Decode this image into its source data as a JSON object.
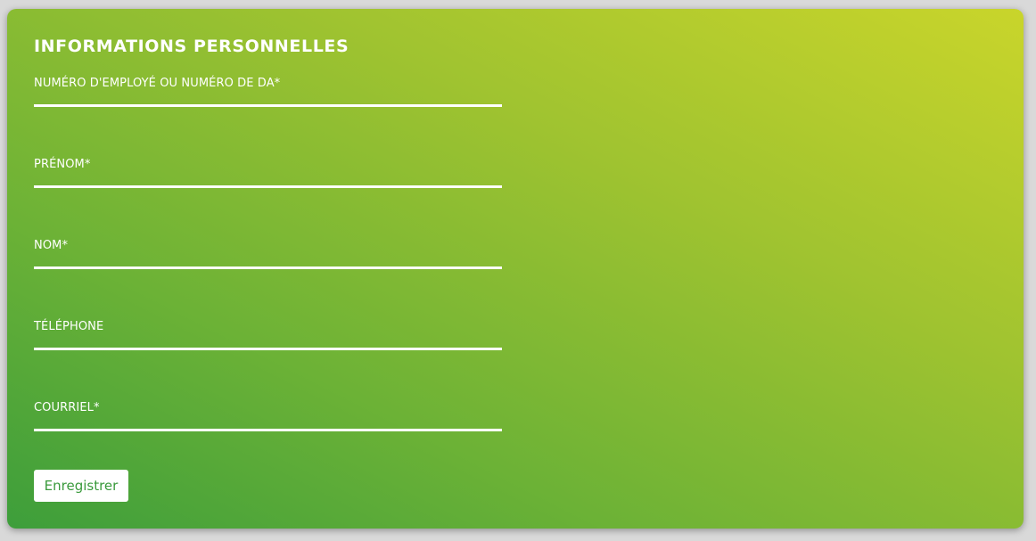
{
  "form": {
    "title": "INFORMATIONS PERSONNELLES",
    "fields": [
      {
        "label": "NUMÉRO D'EMPLOYÉ OU NUMÉRO DE DA*",
        "value": ""
      },
      {
        "label": "PRÉNOM*",
        "value": ""
      },
      {
        "label": "NOM*",
        "value": ""
      },
      {
        "label": "TÉLÉPHONE",
        "value": ""
      },
      {
        "label": "COURRIEL*",
        "value": ""
      }
    ],
    "save_label": "Enregistrer"
  },
  "colors": {
    "gradient_start": "#3d9e3b",
    "gradient_end": "#c9d52b",
    "button_text": "#3a9a3c",
    "text": "#ffffff"
  }
}
